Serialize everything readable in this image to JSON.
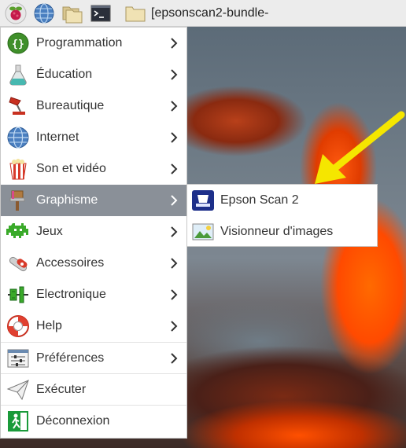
{
  "taskbar": {
    "window_title": "[epsonscan2-bundle-",
    "icons": [
      "raspberry-pi-menu-icon",
      "web-browser-icon",
      "file-manager-icon",
      "terminal-icon",
      "folder-icon"
    ]
  },
  "menu": {
    "items": [
      {
        "label": "Programmation",
        "icon": "programming-icon",
        "submenu": true
      },
      {
        "label": "Éducation",
        "icon": "education-icon",
        "submenu": true
      },
      {
        "label": "Bureautique",
        "icon": "office-icon",
        "submenu": true
      },
      {
        "label": "Internet",
        "icon": "internet-icon",
        "submenu": true
      },
      {
        "label": "Son et vidéo",
        "icon": "sound-video-icon",
        "submenu": true
      },
      {
        "label": "Graphisme",
        "icon": "graphics-icon",
        "submenu": true,
        "active": true
      },
      {
        "label": "Jeux",
        "icon": "games-icon",
        "submenu": true
      },
      {
        "label": "Accessoires",
        "icon": "accessories-icon",
        "submenu": true
      },
      {
        "label": "Electronique",
        "icon": "electronics-icon",
        "submenu": true
      },
      {
        "label": "Help",
        "icon": "help-icon",
        "submenu": true
      },
      {
        "label": "Préférences",
        "icon": "preferences-icon",
        "submenu": true
      },
      {
        "label": "Exécuter",
        "icon": "run-icon",
        "submenu": false
      },
      {
        "label": "Déconnexion",
        "icon": "logout-icon",
        "submenu": false
      }
    ]
  },
  "submenu": {
    "items": [
      {
        "label": "Epson Scan 2",
        "icon": "epson-scan-icon"
      },
      {
        "label": "Visionneur d'images",
        "icon": "image-viewer-icon"
      }
    ]
  },
  "colors": {
    "active_item_bg": "#8a9098",
    "annotation_arrow": "#f5e600"
  }
}
